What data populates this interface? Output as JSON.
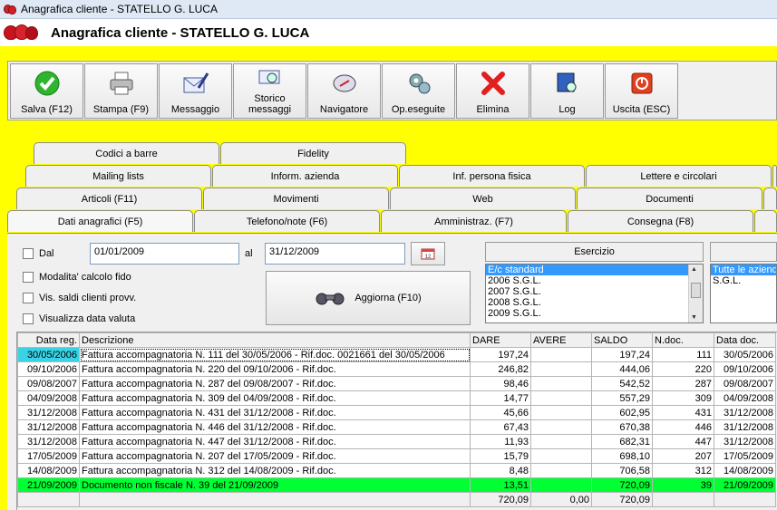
{
  "window": {
    "title": "Anagrafica cliente - STATELLO G. LUCA"
  },
  "header": {
    "title": "Anagrafica cliente - STATELLO G. LUCA"
  },
  "toolbar": {
    "buttons": [
      {
        "label": "Salva (F12)",
        "icon": "check-icon"
      },
      {
        "label": "Stampa (F9)",
        "icon": "printer-icon"
      },
      {
        "label": "Messaggio",
        "icon": "envelope-pen-icon"
      },
      {
        "label": "Storico messaggi",
        "icon": "envelope-search-icon"
      },
      {
        "label": "Navigatore",
        "icon": "compass-icon"
      },
      {
        "label": "Op.eseguite",
        "icon": "gears-icon"
      },
      {
        "label": "Elimina",
        "icon": "delete-x-icon"
      },
      {
        "label": "Log",
        "icon": "book-search-icon"
      },
      {
        "label": "Uscita (ESC)",
        "icon": "power-icon"
      }
    ]
  },
  "tabs": {
    "row1": [
      "Codici a barre",
      "Fidelity"
    ],
    "row2": [
      "Mailing lists",
      "Inform. azienda",
      "Inf. persona fisica",
      "Lettere e circolari"
    ],
    "row3": [
      "Articoli (F11)",
      "Movimenti",
      "Web",
      "Documenti"
    ],
    "row4": [
      "Dati anagrafici (F5)",
      "Telefono/note (F6)",
      "Amministraz. (F7)",
      "Consegna (F8)"
    ]
  },
  "filters": {
    "dal_label": "Dal",
    "dal_value": "01/01/2009",
    "al_label": "al",
    "al_value": "31/12/2009",
    "modalita_label": "Modalita' calcolo fido",
    "vis_saldi_label": "Vis. saldi clienti provv.",
    "visualizza_data_label": "Visualizza data valuta",
    "aggiorna_label": "Aggiorna (F10)"
  },
  "esercizio": {
    "header": "Esercizio",
    "items": [
      "E/c standard",
      "2006 S.G.L.",
      "2007 S.G.L.",
      "2008 S.G.L.",
      "2009 S.G.L."
    ],
    "selected": "E/c standard"
  },
  "aziende": {
    "items": [
      "Tutte le aziende",
      "S.G.L."
    ],
    "selected": "Tutte le aziende"
  },
  "table": {
    "columns": [
      "Data reg.",
      "Descrizione",
      "DARE",
      "AVERE",
      "SALDO",
      "N.doc.",
      "Data doc."
    ],
    "rows": [
      [
        "30/05/2006",
        "Fattura accompagnatoria N. 111 del 30/05/2006 - Rif.doc. 0021661 del 30/05/2006",
        "197,24",
        "",
        "197,24",
        "111",
        "30/05/2006"
      ],
      [
        "09/10/2006",
        "Fattura accompagnatoria N. 220 del 09/10/2006 - Rif.doc.",
        "246,82",
        "",
        "444,06",
        "220",
        "09/10/2006"
      ],
      [
        "09/08/2007",
        "Fattura accompagnatoria N. 287 del 09/08/2007 - Rif.doc.",
        "98,46",
        "",
        "542,52",
        "287",
        "09/08/2007"
      ],
      [
        "04/09/2008",
        "Fattura accompagnatoria N. 309 del 04/09/2008 - Rif.doc.",
        "14,77",
        "",
        "557,29",
        "309",
        "04/09/2008"
      ],
      [
        "31/12/2008",
        "Fattura accompagnatoria N. 431 del 31/12/2008 - Rif.doc.",
        "45,66",
        "",
        "602,95",
        "431",
        "31/12/2008"
      ],
      [
        "31/12/2008",
        "Fattura accompagnatoria N. 446 del 31/12/2008 - Rif.doc.",
        "67,43",
        "",
        "670,38",
        "446",
        "31/12/2008"
      ],
      [
        "31/12/2008",
        "Fattura accompagnatoria N. 447 del 31/12/2008 - Rif.doc.",
        "11,93",
        "",
        "682,31",
        "447",
        "31/12/2008"
      ],
      [
        "17/05/2009",
        "Fattura accompagnatoria N. 207 del 17/05/2009 - Rif.doc.",
        "15,79",
        "",
        "698,10",
        "207",
        "17/05/2009"
      ],
      [
        "14/08/2009",
        "Fattura accompagnatoria N. 312 del 14/08/2009 - Rif.doc.",
        "8,48",
        "",
        "706,58",
        "312",
        "14/08/2009"
      ],
      [
        "21/09/2009",
        "Documento non fiscale N. 39 del 21/09/2009",
        "13,51",
        "",
        "720,09",
        "39",
        "21/09/2009"
      ]
    ],
    "totals": [
      "",
      "",
      "720,09",
      "0,00",
      "720,09",
      "",
      ""
    ]
  },
  "colors": {
    "background": "#ffff00",
    "highlight_row": "#00ff33",
    "selected_cell": "#39d3e6",
    "list_selection": "#3399ff"
  }
}
